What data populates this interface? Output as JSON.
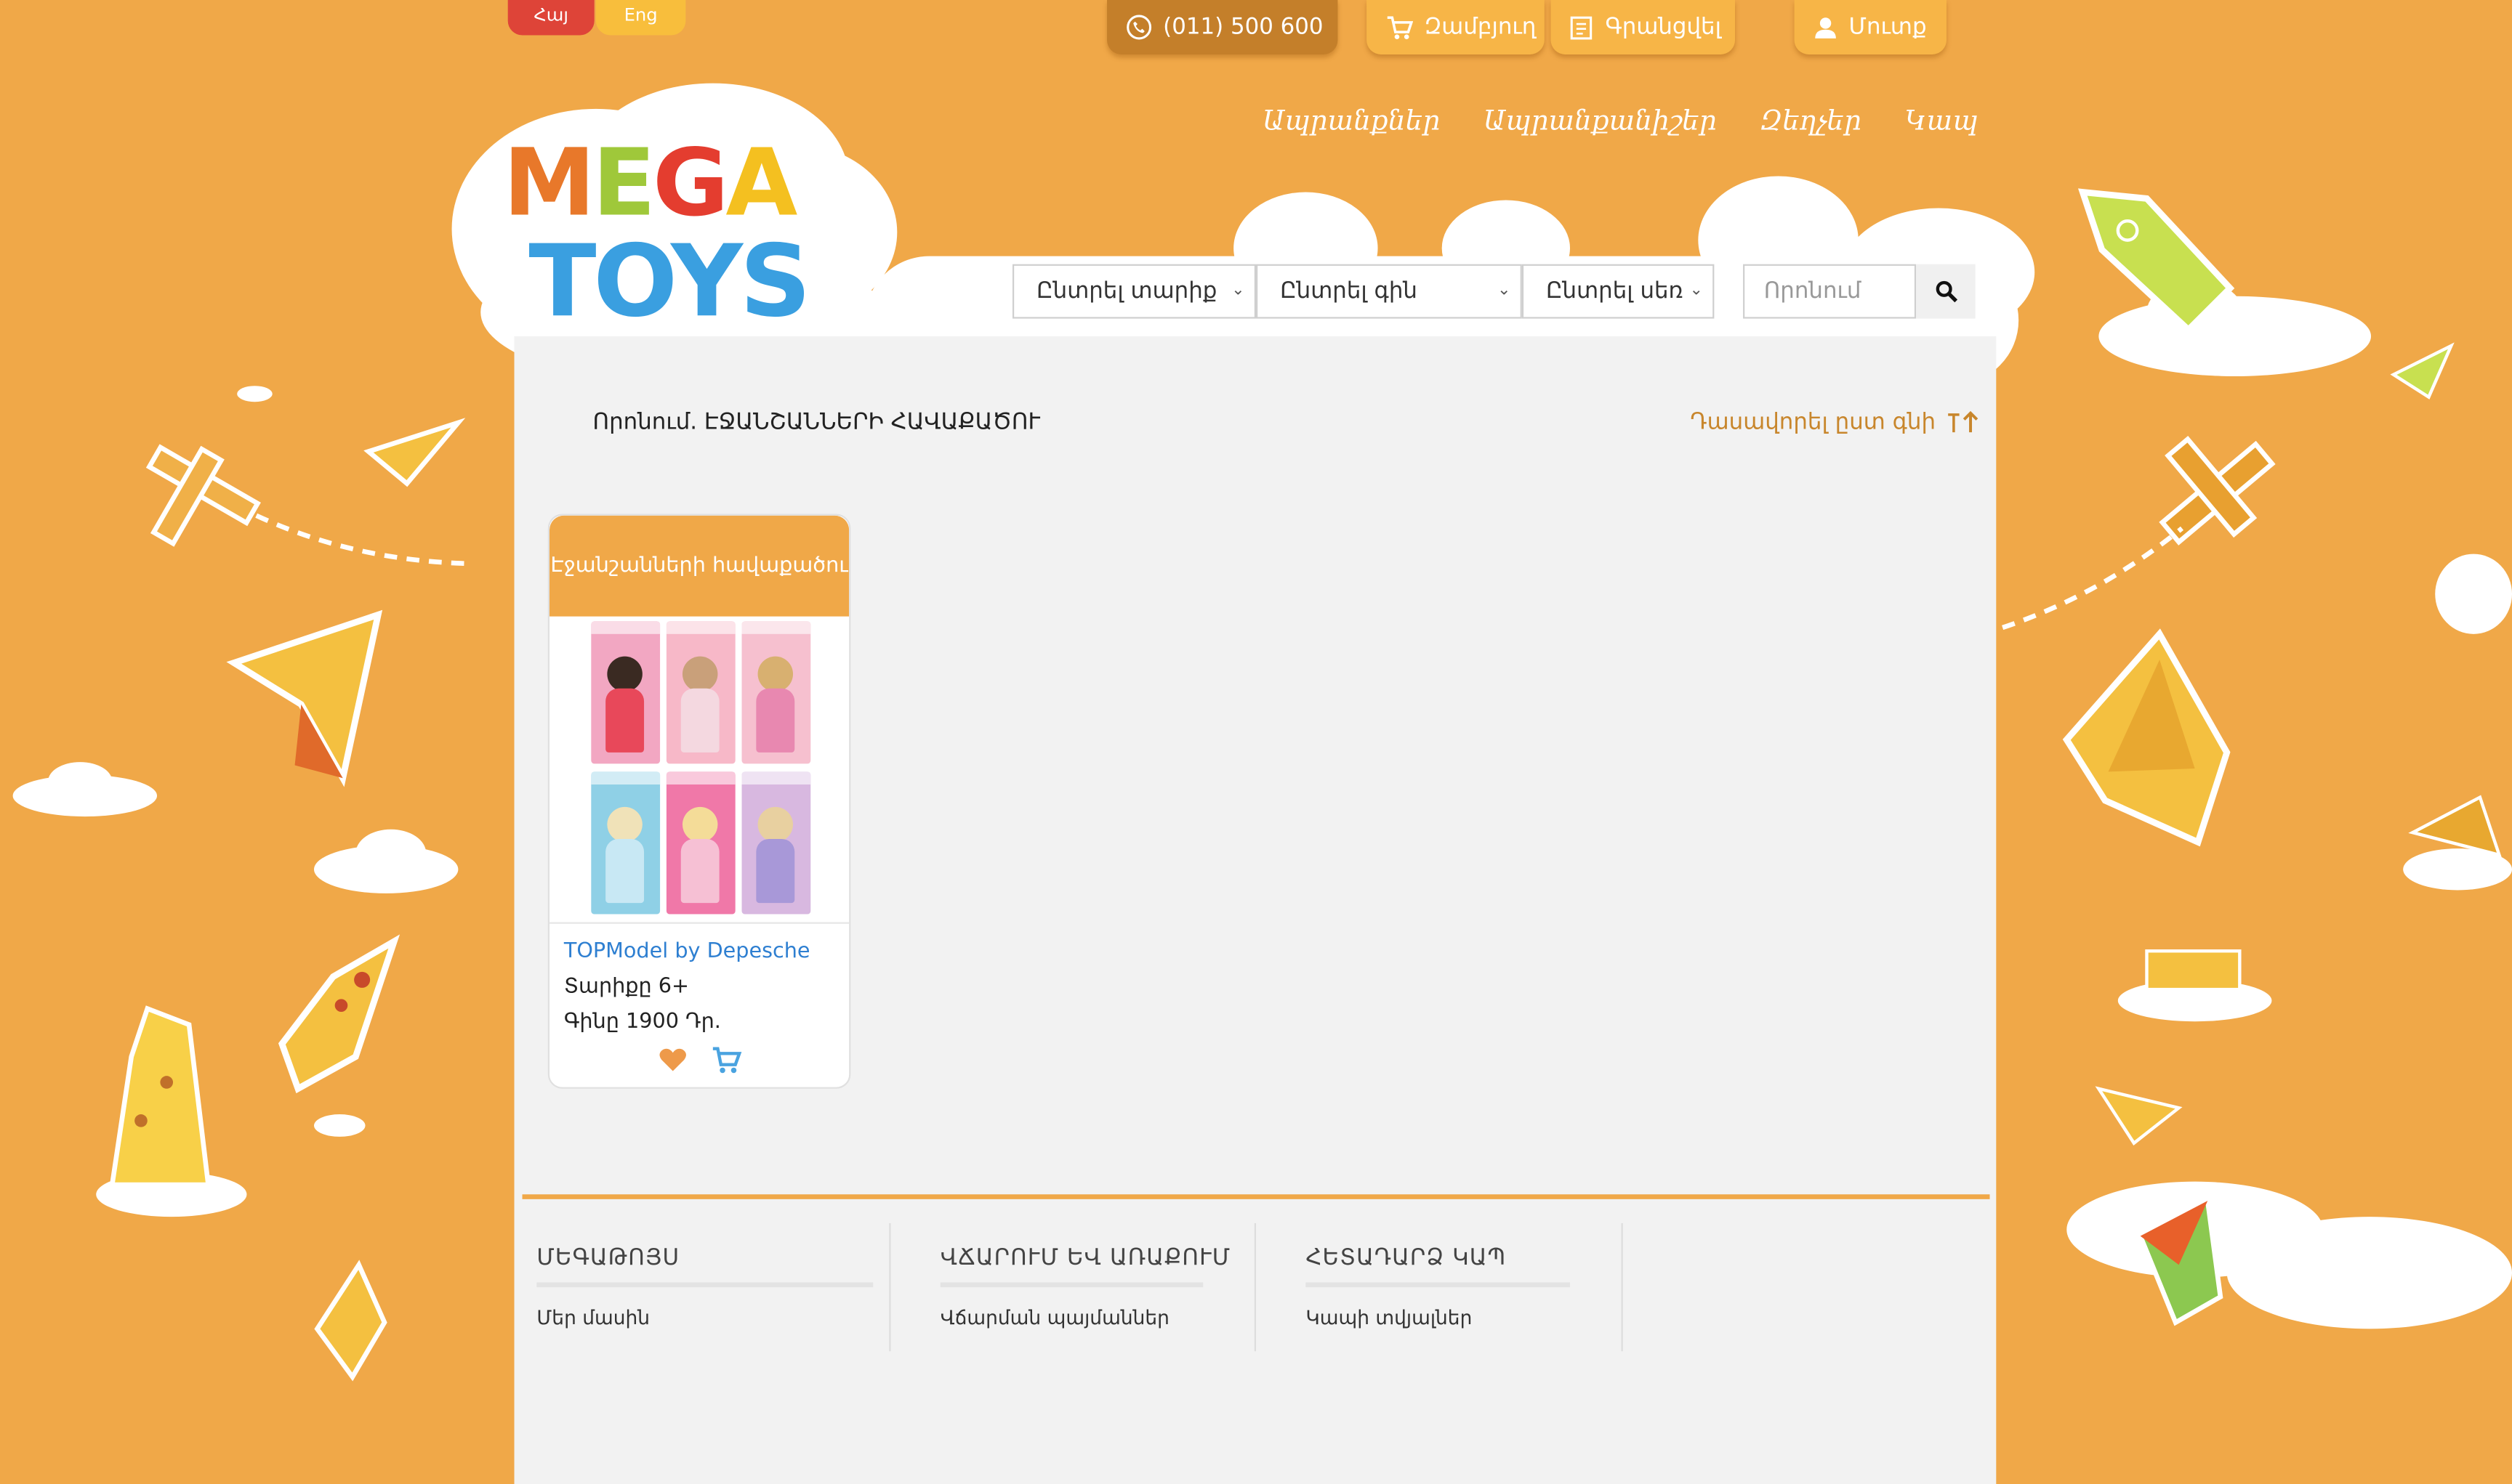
{
  "lang": {
    "hy": "Հայ",
    "en": "Eng"
  },
  "topbar": {
    "phone": "(011) 500 600",
    "cart": "Զամբյուղ",
    "register": "Գրանցվել",
    "login": "Մուտք"
  },
  "nav": [
    "Ապրանքներ",
    "Ապրանքանիշեր",
    "Զեղչեր",
    "Կապ"
  ],
  "logo": {
    "line1": "MEGA",
    "line2": "TOYS"
  },
  "filters": {
    "age": "Ընտրել տարիք",
    "price": "Ընտրել գին",
    "gender": "Ընտրել սեռ",
    "search_placeholder": "Որոնում"
  },
  "heading": "Որոնում. ԷՋԱՆՇԱՆՆԵՐԻ ՀԱՎԱՔԱԾՈՒ",
  "sort_label": "Դասավորել ըստ գնի",
  "product": {
    "title": "Էջանշանների հավաքածու",
    "brand": "TOPModel by Depesche",
    "age": "Տարիքը 6+",
    "price": "Գինը 1900 Դր."
  },
  "footer": {
    "col1": {
      "title": "ՄԵԳԱԹՈՅՍ",
      "link": "Մեր մասին"
    },
    "col2": {
      "title": "ՎՃԱՐՈՒՄ ԵՎ ԱՌԱՔՈՒՄ",
      "link": "Վճարման պայմաններ"
    },
    "col3": {
      "title": "ՀԵՏԱԴԱՐՁ ԿԱՊ",
      "link": "Կապի տվյալներ"
    }
  },
  "colors": {
    "background": "#f0a848",
    "accent_red": "#de4438",
    "link_blue": "#2e7fd1"
  }
}
